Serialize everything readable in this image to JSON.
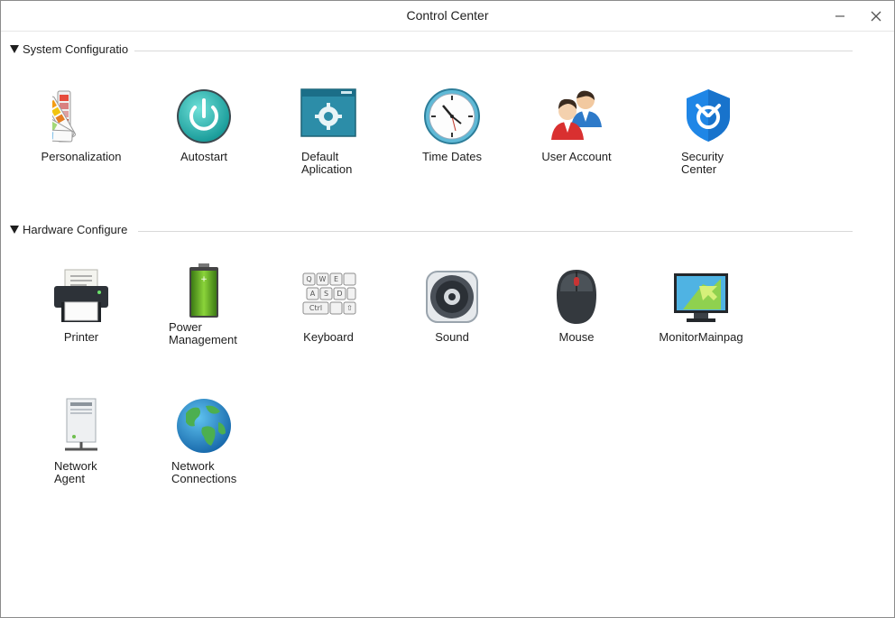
{
  "window": {
    "title": "Control Center"
  },
  "sections": [
    {
      "label": "System Configuratio",
      "items": [
        {
          "label": "Personalization",
          "icon": "personalization-icon"
        },
        {
          "label": "Autostart",
          "icon": "autostart-icon"
        },
        {
          "label": "Default\nAplication",
          "icon": "default-application-icon"
        },
        {
          "label": "Time Dates",
          "icon": "clock-icon"
        },
        {
          "label": "User Account",
          "icon": "user-account-icon"
        },
        {
          "label": "Security\nCenter",
          "icon": "security-shield-icon"
        }
      ]
    },
    {
      "label": "Hardware Configure",
      "items": [
        {
          "label": "Printer",
          "icon": "printer-icon"
        },
        {
          "label": "Power\nManagement",
          "icon": "battery-icon"
        },
        {
          "label": "Keyboard",
          "icon": "keyboard-icon"
        },
        {
          "label": "Sound",
          "icon": "speaker-icon"
        },
        {
          "label": "Mouse",
          "icon": "mouse-icon"
        },
        {
          "label": "MonitorMainpag",
          "icon": "monitor-icon"
        },
        {
          "label": "Network\nAgent",
          "icon": "network-agent-icon"
        },
        {
          "label": "Network\nConnections",
          "icon": "globe-icon"
        }
      ]
    }
  ]
}
